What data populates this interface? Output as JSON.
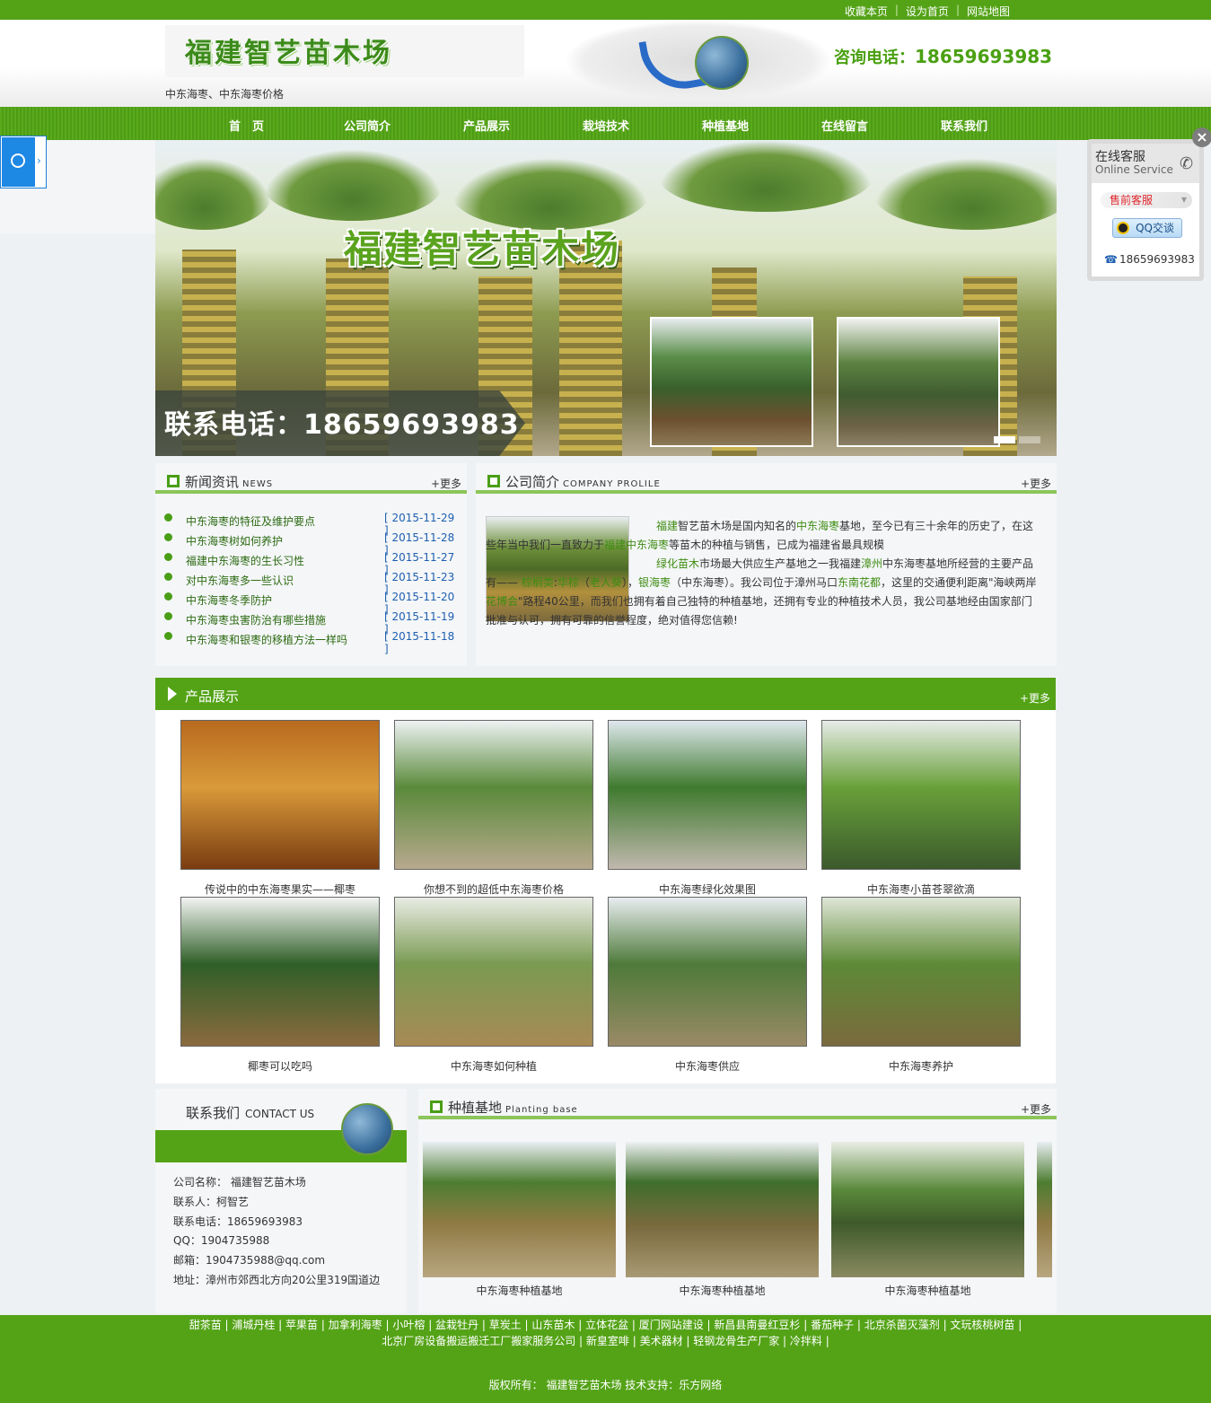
{
  "topbar": {
    "links": [
      "收藏本页",
      "设为首页",
      "网站地图"
    ]
  },
  "header": {
    "logo_text": "福建智艺苗木场",
    "tagline": "中东海枣、中东海枣价格",
    "phone_label": "咨询电话：",
    "phone": "18659693983"
  },
  "nav": {
    "items": [
      "首　页",
      "公司简介",
      "产品展示",
      "栽培技术",
      "种植基地",
      "在线留言",
      "联系我们"
    ]
  },
  "banner": {
    "title": "福建智艺苗木场",
    "phone": "联系电话：18659693983"
  },
  "news": {
    "title": "新闻资讯",
    "title_en": "NEWS",
    "more": "+更多",
    "items": [
      {
        "title": "中东海枣的特征及维护要点",
        "date": "[ 2015-11-29 ]"
      },
      {
        "title": "中东海枣树如何养护",
        "date": "[ 2015-11-28 ]"
      },
      {
        "title": "福建中东海枣的生长习性",
        "date": "[ 2015-11-27 ]"
      },
      {
        "title": "对中东海枣多一些认识",
        "date": "[ 2015-11-23 ]"
      },
      {
        "title": "中东海枣冬季防护",
        "date": "[ 2015-11-20 ]"
      },
      {
        "title": "中东海枣虫害防治有哪些措施",
        "date": "[ 2015-11-19 ]"
      },
      {
        "title": "中东海枣和银枣的移植方法一样吗",
        "date": "[ 2015-11-18 ]"
      }
    ]
  },
  "about": {
    "title": "公司简介",
    "title_en": "COMPANY PROLILE",
    "more": "+更多",
    "p1": "福建",
    "p2": "智艺苗木场是国内知名的",
    "p3": "中东海枣",
    "p4": "基地，至今已有三十余年的历史了，在这些年当中我们一直致力于",
    "p5": "福建中东海枣",
    "p6": "等苗木的种植与销售，已成为福建省最具规模",
    "p7": "绿化苗木",
    "p8": "市场最大供应生产基地之一我福建",
    "p9": "漳州",
    "p10": "中东海枣基地所经营的主要产品有—— ",
    "p11": "棕榈类",
    "p12": ":",
    "p13": "华棕",
    "p14": "（",
    "p15": "老人葵",
    "p16": "），",
    "p17": "银海枣",
    "p18": "（中东海枣）。我公司位于漳州马口",
    "p19": "东南花都",
    "p20": "，这里的交通便利距离\"海峡两岸",
    "p21": "花博会",
    "p22": "\"路程40公里，而我们也拥有着自己独特的种植基地，还拥有专业的种植技术人员，我公司基地经由国家部门批准与认可，拥有可靠的信誉程度，绝对值得您信赖!"
  },
  "products": {
    "title": "产品展示",
    "more": "+更多",
    "items": [
      {
        "caption": "传说中的中东海枣果实——椰枣",
        "colors": [
          "#b86a1e",
          "#d99a3a",
          "#7a3c10"
        ]
      },
      {
        "caption": "你想不到的超低中东海枣价格",
        "colors": [
          "#eef2f3",
          "#5a8a3a",
          "#b8a98e"
        ]
      },
      {
        "caption": "中东海枣绿化效果图",
        "colors": [
          "#dfe8ee",
          "#3f7a2e",
          "#c0b8ae"
        ]
      },
      {
        "caption": "中东海枣小苗苍翠欲滴",
        "colors": [
          "#e7ece8",
          "#69a03a",
          "#3b5a2c"
        ]
      },
      {
        "caption": "椰枣可以吃吗",
        "colors": [
          "#f2f4f2",
          "#2f5f28",
          "#8b6a3e"
        ]
      },
      {
        "caption": "中东海枣如何种植",
        "colors": [
          "#e9ece4",
          "#7a9a52",
          "#a88a55"
        ]
      },
      {
        "caption": "中东海枣供应",
        "colors": [
          "#e8edf0",
          "#4e7a3a",
          "#9a8a66"
        ]
      },
      {
        "caption": "中东海枣养护",
        "colors": [
          "#dfe6d6",
          "#5d8a36",
          "#7b6a3e"
        ]
      }
    ]
  },
  "contact": {
    "title": "联系我们",
    "title_en": "CONTACT US",
    "lines": [
      "公司名称： 福建智艺苗木场",
      "联系人：柯智艺",
      "联系电话：18659693983",
      "QQ：1904735988",
      "邮箱：1904735988@qq.com",
      "地址：漳州市郊西北方向20公里319国道边"
    ]
  },
  "base": {
    "title": "种植基地",
    "title_en": "Planting base",
    "more": "+更多",
    "items": [
      {
        "caption": "中东海枣种植基地"
      },
      {
        "caption": "中东海枣种植基地"
      },
      {
        "caption": "中东海枣种植基地"
      }
    ]
  },
  "footer": {
    "links_line1": "甜茶苗 | 浦城丹桂 | 苹果苗 | 加拿利海枣 | 小叶榕 | 盆栽牡丹 | 草炭土 | 山东苗木 | 立体花盆 | 厦门网站建设 | 新昌县南曼红豆杉 | 番茄种子 | 北京杀菌灭藻剂 | 文玩核桃树苗 |",
    "links_line2": "北京厂房设备搬运搬迁工厂搬家服务公司 | 新皇室啡 | 美术器材 | 轻钢龙骨生产厂家 | 冷拌料 |",
    "copyright": "版权所有： 福建智艺苗木场 技术支持：乐方网络"
  },
  "service": {
    "title": "在线客服",
    "subtitle": "Online Service",
    "presale": "售前客服",
    "qq_label": "QQ交谈",
    "phone": "18659693983",
    "close": "×"
  },
  "colors": {
    "brand_green": "#54a317",
    "link_blue": "#1f5fb0",
    "accent_light": "#8cc55a"
  }
}
